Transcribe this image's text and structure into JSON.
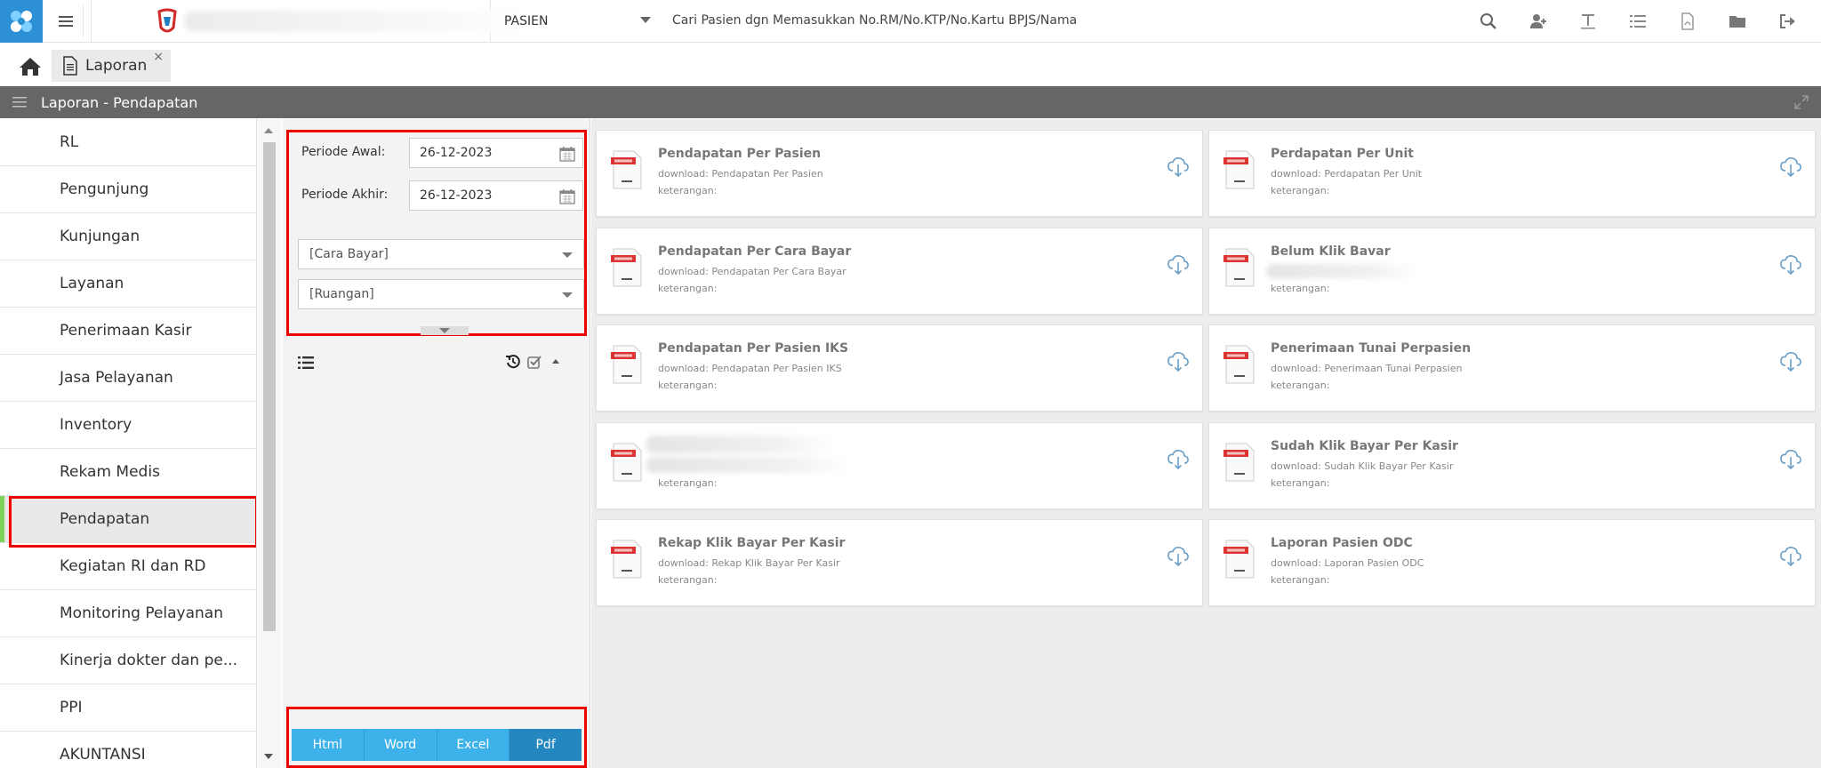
{
  "topbar": {
    "patient_selector": "PASIEN",
    "search_hint": "Cari Pasien dgn Memasukkan No.RM/No.KTP/No.Kartu BPJS/Nama",
    "icons": [
      "search-icon",
      "add-user-icon",
      "text-icon",
      "list-icon",
      "pdf-file-icon",
      "folder-icon",
      "logout-icon"
    ]
  },
  "tabs": {
    "home_icon": "home-icon",
    "active_tab_label": "Laporan",
    "close_glyph": "×"
  },
  "section": {
    "title": "Laporan - Pendapatan"
  },
  "sidebar": {
    "items": [
      {
        "label": "RL"
      },
      {
        "label": "Pengunjung"
      },
      {
        "label": "Kunjungan"
      },
      {
        "label": "Layanan"
      },
      {
        "label": "Penerimaan Kasir"
      },
      {
        "label": "Jasa Pelayanan"
      },
      {
        "label": "Inventory"
      },
      {
        "label": "Rekam Medis"
      },
      {
        "label": "Pendapatan",
        "active": true
      },
      {
        "label": "Kegiatan RI dan RD"
      },
      {
        "label": "Monitoring Pelayanan"
      },
      {
        "label": "Kinerja dokter dan pe..."
      },
      {
        "label": "PPI"
      },
      {
        "label": "AKUNTANSI"
      }
    ]
  },
  "filters": {
    "periode_awal_label": "Periode Awal:",
    "periode_awal_value": "26-12-2023",
    "periode_akhir_label": "Periode Akhir:",
    "periode_akhir_value": "26-12-2023",
    "cara_bayar_placeholder": "[Cara Bayar]",
    "ruangan_placeholder": "[Ruangan]"
  },
  "export": {
    "buttons": [
      "Html",
      "Word",
      "Excel",
      "Pdf"
    ],
    "selected": "Pdf"
  },
  "reports": [
    {
      "title": "Pendapatan Per Pasien",
      "download": "download: Pendapatan Per Pasien",
      "keterangan": "keterangan:"
    },
    {
      "title": "Perdapatan Per Unit",
      "download": "download: Perdapatan Per Unit",
      "keterangan": "keterangan:"
    },
    {
      "title": "Pendapatan Per Cara Bayar",
      "download": "download: Pendapatan Per Cara Bayar",
      "keterangan": "keterangan:"
    },
    {
      "title": "Belum Klik Bavar",
      "download": "",
      "keterangan": "keterangan:"
    },
    {
      "title": "Pendapatan Per Pasien IKS",
      "download": "download: Pendapatan Per Pasien IKS",
      "keterangan": "keterangan:"
    },
    {
      "title": "Penerimaan Tunai Perpasien",
      "download": "download: Penerimaan Tunai Perpasien",
      "keterangan": "keterangan:"
    },
    {
      "title": "",
      "download": "",
      "keterangan": "keterangan:"
    },
    {
      "title": "Sudah Klik Bayar Per Kasir",
      "download": "download: Sudah Klik Bayar Per Kasir",
      "keterangan": "keterangan:"
    },
    {
      "title": "Rekap Klik Bayar Per Kasir",
      "download": "download: Rekap Klik Bayar Per Kasir",
      "keterangan": "keterangan:"
    },
    {
      "title": "Laporan Pasien ODC",
      "download": "download: Laporan Pasien ODC",
      "keterangan": "keterangan:"
    }
  ],
  "colors": {
    "accent_blue": "#3db2ea",
    "accent_blue_active": "#2487c0",
    "highlight_red": "#e00000",
    "active_marker_green": "#7bd35c",
    "section_bar": "#666666"
  }
}
